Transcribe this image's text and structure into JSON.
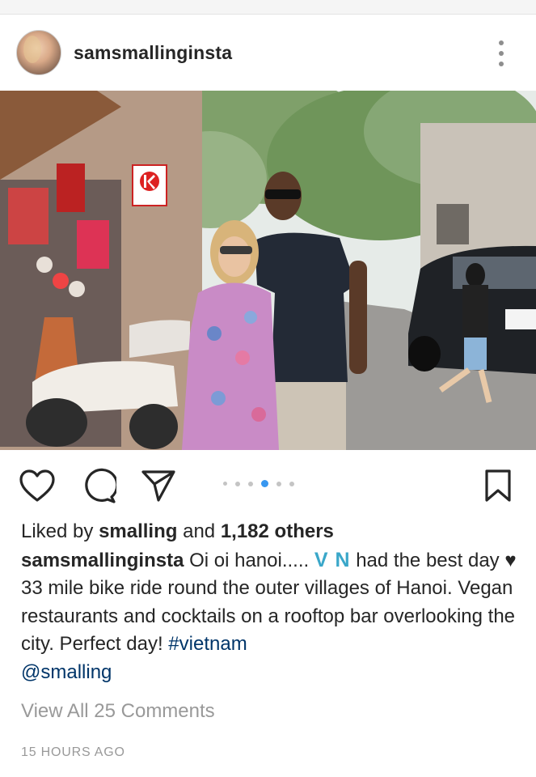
{
  "post": {
    "username": "samsmallinginsta",
    "likes": {
      "prefix": "Liked by",
      "liker": "smalling",
      "conjunction": "and",
      "others": "1,182 others"
    },
    "caption": {
      "username": "samsmallinginsta",
      "text_part1": "Oi oi hanoi.....",
      "flag": "V N",
      "text_part2": "had the best day",
      "heart": "♥",
      "text_part3": "33 mile bike ride round the outer villages of Hanoi. Vegan restaurants and cocktails on a rooftop bar overlooking the city. Perfect day!",
      "hashtag": "#vietnam",
      "mention": "@smalling"
    },
    "view_comments": "View All 25 Comments",
    "timestamp": "15 HOURS AGO",
    "carousel": {
      "count": 6,
      "active_index": 3
    }
  },
  "icons": {
    "more": "more-vertical-icon",
    "like": "heart-icon",
    "comment": "comment-bubble-icon",
    "share": "send-arrow-icon",
    "save": "bookmark-icon"
  },
  "colors": {
    "text": "#262626",
    "muted": "#999999",
    "link": "#003569",
    "carousel_active": "#3897f0",
    "flag_text": "#3aa7c9"
  }
}
